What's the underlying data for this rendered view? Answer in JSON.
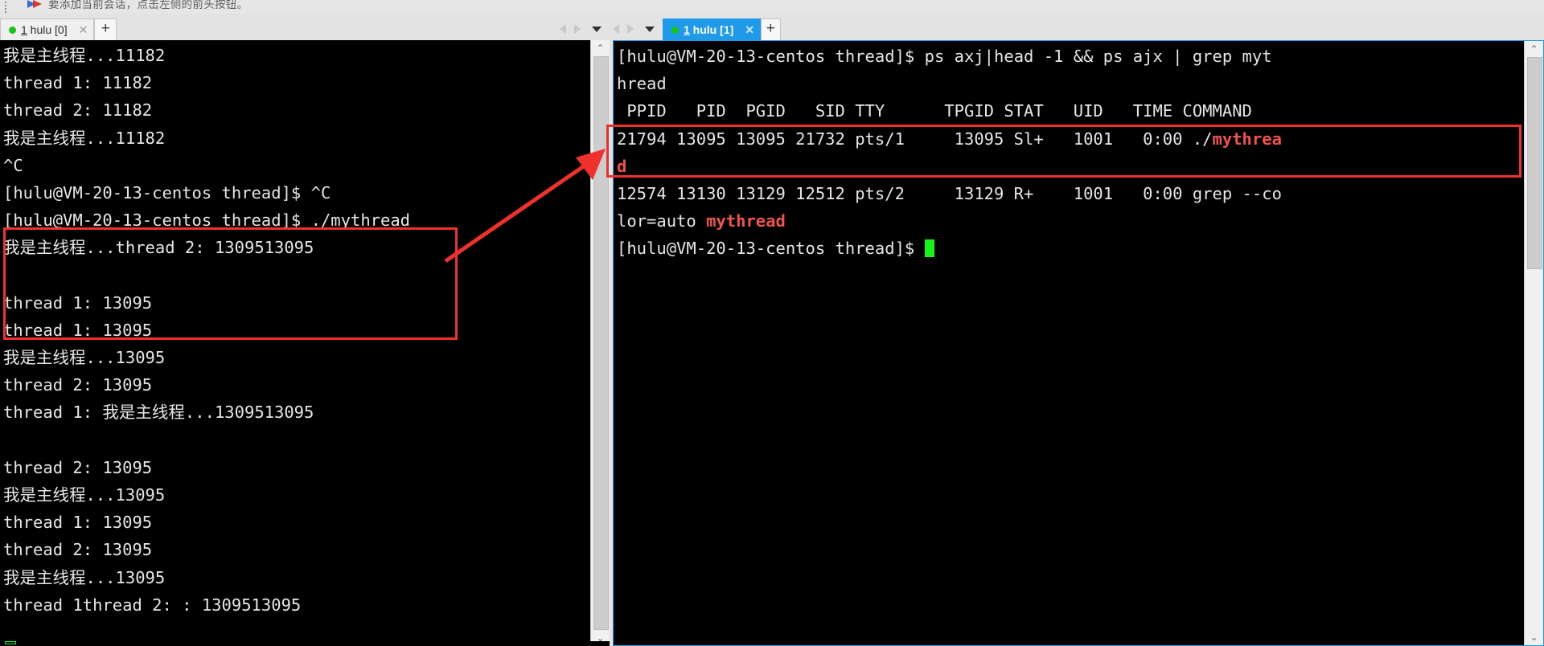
{
  "hint": {
    "text": "要添加当前会话，点击左侧的前头按钮。",
    "logo_icon": "xshell-logo-icon",
    "grip_icon": "drag-grip-icon"
  },
  "panels": {
    "left": {
      "nav": {
        "prev_icon": "chevron-left-icon",
        "prev_label": "◀",
        "next_icon": "chevron-right-icon",
        "next_label": "▶",
        "menu_icon": "chevron-down-icon",
        "menu_label": "▼"
      },
      "tab": {
        "accel": "1",
        "label": " hulu [0]",
        "close_label": "✕",
        "status_icon": "connected-dot-icon"
      },
      "add_tab_label": "+",
      "scrollbar": {
        "up_label": "⌃",
        "down_label": "⌄"
      },
      "terminal": {
        "lines": [
          {
            "text": "我是主线程...11182"
          },
          {
            "text": "thread 1: 11182"
          },
          {
            "text": "thread 2: 11182"
          },
          {
            "text": "我是主线程...11182"
          },
          {
            "text": "^C"
          },
          {
            "text": "[hulu@VM-20-13-centos thread]$ ^C"
          },
          {
            "text": "[hulu@VM-20-13-centos thread]$ ./mythread"
          },
          {
            "text": "我是主线程...thread 2: 1309513095"
          },
          {
            "text": ""
          },
          {
            "text": "thread 1: 13095"
          },
          {
            "text": "thread 1: 13095"
          },
          {
            "text": "我是主线程...13095"
          },
          {
            "text": "thread 2: 13095"
          },
          {
            "text": "thread 1: 我是主线程...1309513095"
          },
          {
            "text": ""
          },
          {
            "text": "thread 2: 13095"
          },
          {
            "text": "我是主线程...13095"
          },
          {
            "text": "thread 1: 13095"
          },
          {
            "text": "thread 2: 13095"
          },
          {
            "text": "我是主线程...13095"
          },
          {
            "text": "thread 1thread 2: : 1309513095"
          }
        ]
      }
    },
    "right": {
      "nav": {
        "prev_icon": "chevron-left-icon",
        "prev_label": "◀",
        "next_icon": "chevron-right-icon",
        "next_label": "▶",
        "menu_icon": "chevron-down-icon",
        "menu_label": "▼"
      },
      "tab": {
        "accel": "1",
        "label": " hulu [1]",
        "close_label": "✕",
        "status_icon": "connected-dot-icon"
      },
      "add_tab_label": "+",
      "scrollbar": {
        "up_label": "⌃",
        "down_label": "⌄"
      },
      "terminal": {
        "prompt": "[hulu@VM-20-13-centos thread]$ ",
        "command": "ps axj|head -1 && ps ajx | grep myt",
        "command_wrap": "hread",
        "header": " PPID   PID  PGID   SID TTY      TPGID STAT   UID   TIME COMMAND",
        "rows": [
          {
            "plain": "21794 13095 13095 21732 pts/1     13095 Sl+   1001   0:00 ./",
            "highlight": "mythrea",
            "wrap_highlight": "d"
          },
          {
            "plain": "12574 13130 13129 12512 pts/2     13129 R+    1001   0:00 grep --co",
            "wrap_plain": "lor=auto ",
            "wrap_highlight": "mythread"
          }
        ],
        "last_prompt": "[hulu@VM-20-13-centos thread]$ ",
        "cursor_icon": "block-cursor-icon"
      }
    }
  },
  "annotations": {
    "left_box_name": "red-highlight-box-left",
    "right_box_name": "red-highlight-box-right",
    "arrow_name": "red-arrow-annotation",
    "color": "#f0302c"
  },
  "colors": {
    "accent": "#1e9ae8",
    "terminal_bg": "#000000",
    "terminal_fg": "#e6e6e6",
    "highlight_red": "#f0524f",
    "cursor_green": "#18f218",
    "annotation_red": "#f0302c",
    "chrome_bg": "#e3e3e3"
  }
}
